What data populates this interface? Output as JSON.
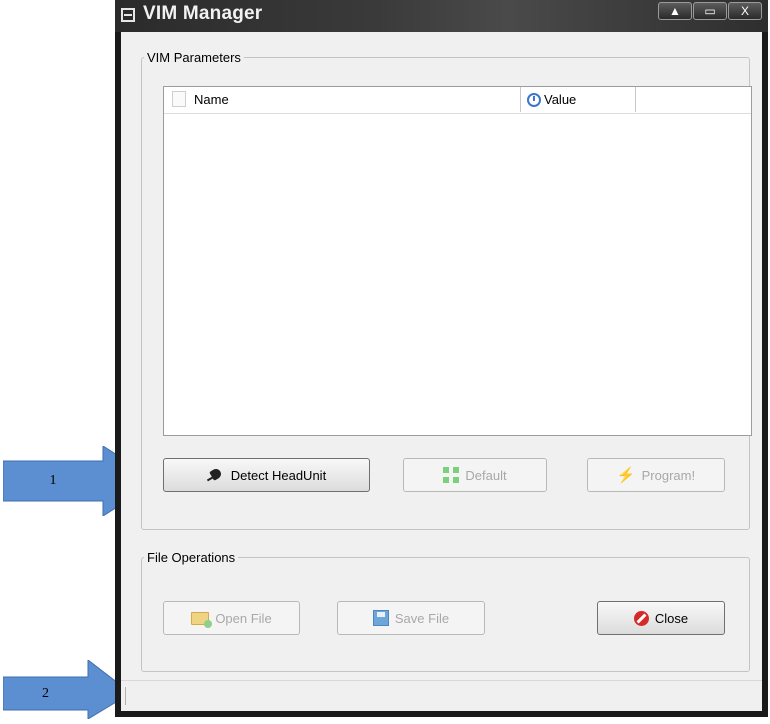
{
  "annotations": {
    "arrow1_label": "1",
    "arrow2_label": "2",
    "arrow_color": "#5b8fd1"
  },
  "window": {
    "title": "VIM Manager",
    "caption_buttons": [
      "▲",
      "▭",
      "X"
    ]
  },
  "vim_parameters": {
    "legend": "VIM Parameters",
    "columns": [
      {
        "label": "Name",
        "icon": "page-icon"
      },
      {
        "label": "Value",
        "icon": "clock-icon"
      }
    ],
    "rows": [],
    "buttons": {
      "detect": {
        "label": "Detect HeadUnit",
        "icon": "plug-icon",
        "enabled": true
      },
      "default": {
        "label": "Default",
        "icon": "default-icon",
        "enabled": false
      },
      "program": {
        "label": "Program!",
        "icon": "bolt-icon",
        "enabled": false
      }
    }
  },
  "file_operations": {
    "legend": "File Operations",
    "buttons": {
      "open": {
        "label": "Open File",
        "icon": "folder-icon",
        "enabled": false
      },
      "save": {
        "label": "Save File",
        "icon": "disk-icon",
        "enabled": false
      },
      "close": {
        "label": "Close",
        "icon": "stop-icon",
        "enabled": true
      }
    }
  },
  "status_bar": {
    "text": ""
  }
}
